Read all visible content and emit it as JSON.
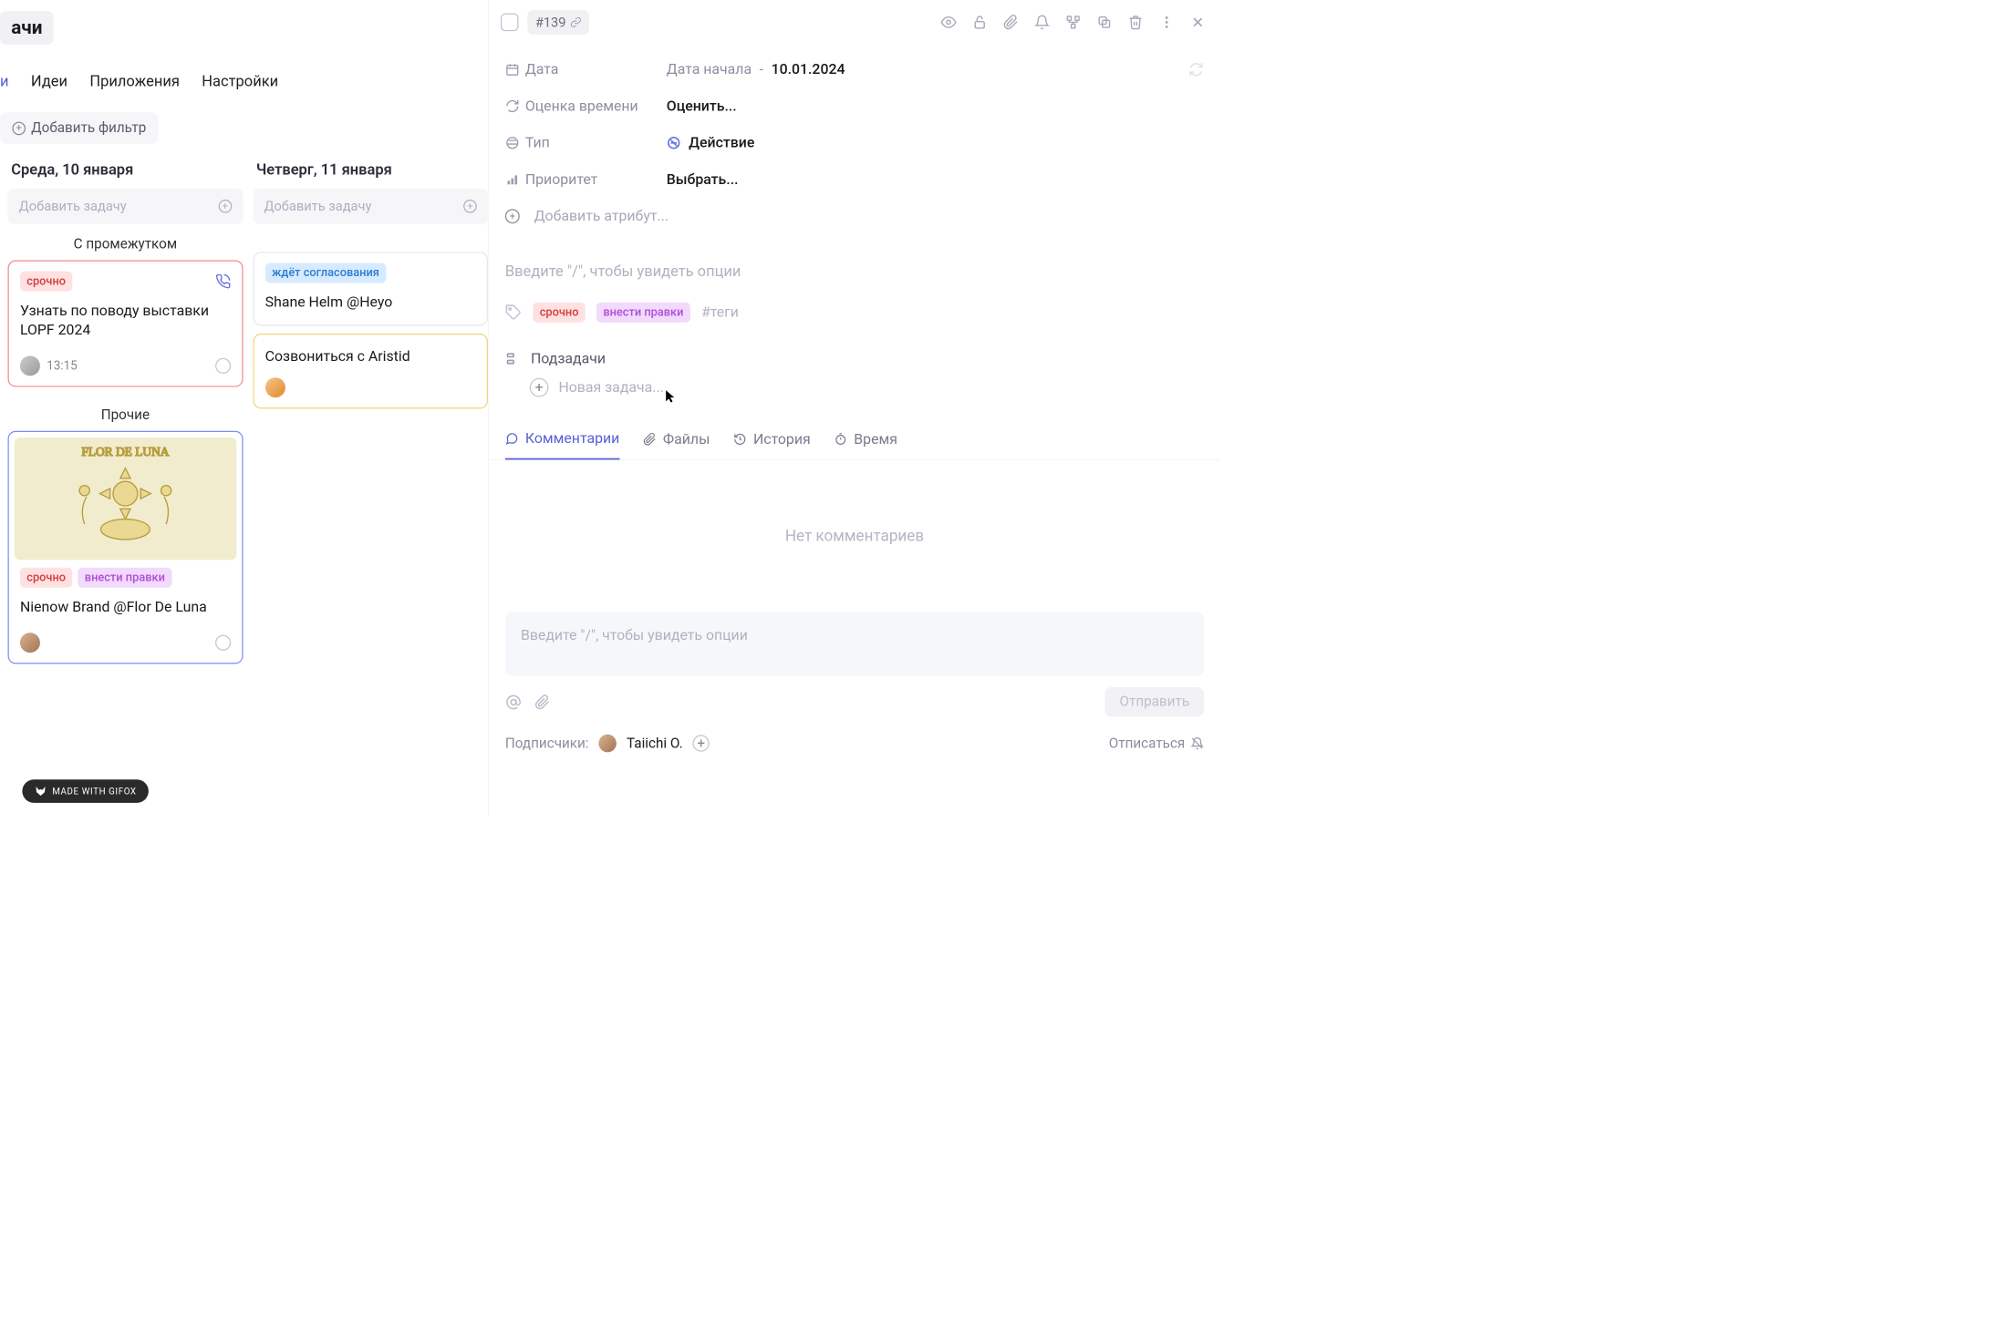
{
  "left": {
    "title": "ачи",
    "nav": {
      "tasks": "и",
      "ideas": "Идеи",
      "apps": "Приложения",
      "settings": "Настройки"
    },
    "add_filter": "Добавить фильтр",
    "col1": {
      "heading": "Среда, 10 января",
      "add_task": "Добавить задачу",
      "section1": "С промежутком",
      "card1": {
        "tag": "срочно",
        "title": "Узнать по поводу выставки LOPF 2024",
        "time": "13:15"
      },
      "section2": "Прочие",
      "card2": {
        "tag1": "срочно",
        "tag2": "внести правки",
        "title": "Nienow Brand @Flor De Luna"
      }
    },
    "col2": {
      "heading": "Четверг, 11 января",
      "add_task": "Добавить задачу",
      "card1": {
        "tag": "ждёт согласования",
        "title": "Shane Helm @Heyo"
      },
      "card2": {
        "title": "Созвониться с Aristid"
      }
    },
    "made_with": "MADE WITH GIFOX"
  },
  "right": {
    "task_id": "#139",
    "attrs": {
      "date_label": "Дата",
      "date_start": "Дата начала",
      "date_end": "10.01.2024",
      "time_estimate_label": "Оценка времени",
      "time_estimate_value": "Оценить...",
      "type_label": "Тип",
      "type_value": "Действие",
      "priority_label": "Приоритет",
      "priority_value": "Выбрать...",
      "add_attr": "Добавить атрибут..."
    },
    "desc_placeholder": "Введите \"/\", чтобы увидеть опции",
    "tags": {
      "t1": "срочно",
      "t2": "внести правки",
      "hint": "#теги"
    },
    "subtasks": {
      "header": "Подзадачи",
      "add": "Новая задача..."
    },
    "tabs": {
      "comments": "Комментарии",
      "files": "Файлы",
      "history": "История",
      "time": "Время"
    },
    "comments_empty": "Нет комментариев",
    "comment_input_placeholder": "Введите \"/\", чтобы увидеть опции",
    "send": "Отправить",
    "subscribers_label": "Подписчики:",
    "subscriber_name": "Taiichi O.",
    "unsubscribe": "Отписаться"
  }
}
